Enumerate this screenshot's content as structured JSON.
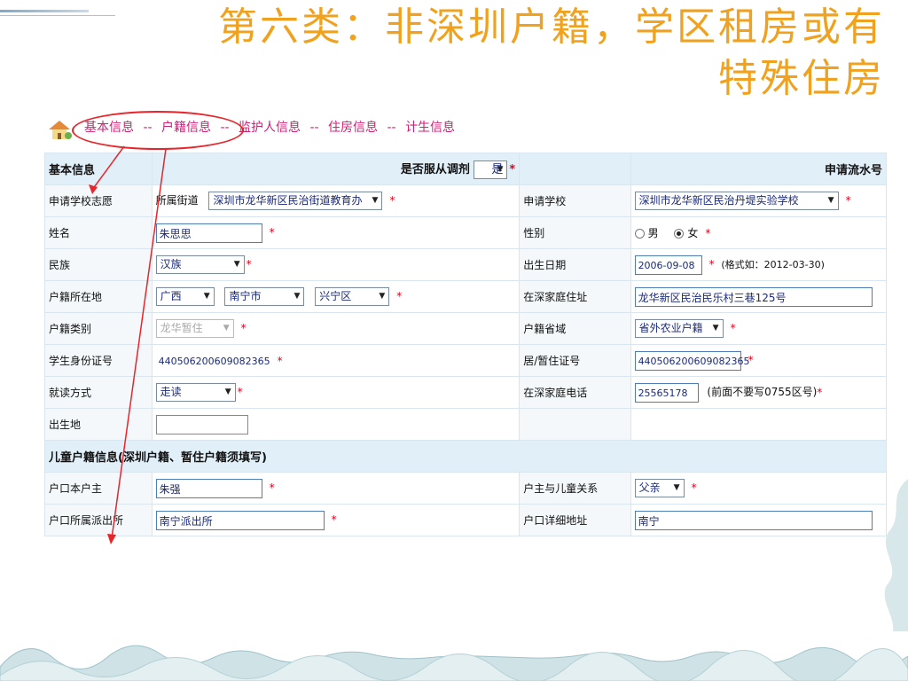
{
  "slide": {
    "title_line1": "第六类：非深圳户籍，学区租房或有",
    "title_line2": "特殊住房"
  },
  "nav": {
    "items": [
      "基本信息",
      "户籍信息",
      "监护人信息",
      "住房信息",
      "计生信息"
    ],
    "separator": "--",
    "icon": "house-icon"
  },
  "form": {
    "section_basic": "基本信息",
    "obey_label": "是否服从调剂",
    "obey_value": "是",
    "serial_label": "申请流水号",
    "rows": {
      "school_pref_label": "申请学校志愿",
      "street_label": "所属街道",
      "street_value": "深圳市龙华新区民治街道教育办",
      "school_label": "申请学校",
      "school_value": "深圳市龙华新区民治丹堤实验学校",
      "name_label": "姓名",
      "name_value": "朱思思",
      "gender_label": "性别",
      "gender_male": "男",
      "gender_female": "女",
      "gender_selected": "女",
      "ethnic_label": "民族",
      "ethnic_value": "汉族",
      "birth_label": "出生日期",
      "birth_value": "2006-09-08",
      "birth_hint": "(格式如：2012-03-30)",
      "hukou_loc_label": "户籍所在地",
      "province_value": "广西",
      "city_value": "南宁市",
      "district_value": "兴宁区",
      "home_addr_label": "在深家庭住址",
      "home_addr_value": "龙华新区民治民乐村三巷125号",
      "hukou_type_label": "户籍类别",
      "hukou_type_value": "龙华暂住",
      "hukou_prov_label": "户籍省域",
      "hukou_prov_value": "省外农业户籍",
      "id_label": "学生身份证号",
      "id_value": "440506200609082365",
      "residence_label": "居/暂住证号",
      "residence_value": "440506200609082365",
      "study_label": "就读方式",
      "study_value": "走读",
      "phone_label": "在深家庭电话",
      "phone_value": "25565178",
      "phone_hint": "(前面不要写0755区号)",
      "birthplace_label": "出生地",
      "birthplace_value": ""
    },
    "section_child": "儿童户籍信息(深圳户籍、暂住户籍须填写)",
    "child": {
      "householder_label": "户口本户主",
      "householder_value": "朱强",
      "relation_label": "户主与儿童关系",
      "relation_value": "父亲",
      "police_label": "户口所属派出所",
      "police_value": "南宁派出所",
      "detail_addr_label": "户口详细地址",
      "detail_addr_value": "南宁"
    },
    "required_mark": "*"
  },
  "colors": {
    "title": "#f0a21e",
    "nav_link": "#cc2277",
    "annotation": "#e8252a",
    "section_bg": "#e1eff8"
  }
}
